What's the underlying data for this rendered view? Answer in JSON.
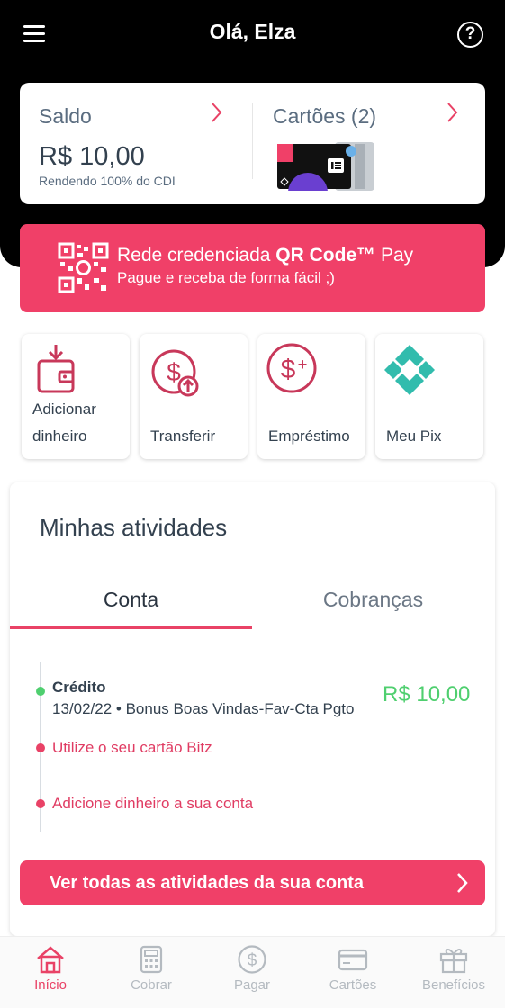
{
  "header": {
    "greeting": "Olá, Elza",
    "menu_icon": "hamburger-icon",
    "help_icon": "question-circle-icon"
  },
  "balance": {
    "saldo_label": "Saldo",
    "saldo_value": "R$ 10,00",
    "saldo_sub": "Rendendo 100% do CDI",
    "cartoes_label": "Cartões (2)"
  },
  "qr_banner": {
    "title_prefix": "Rede credenciada ",
    "title_bold": "QR Code™",
    "title_suffix": " Pay",
    "subtitle": "Pague e receba de forma fácil ;)"
  },
  "actions": [
    {
      "label": "Adicionar dinheiro",
      "icon": "wallet-add-icon"
    },
    {
      "label": "Transferir",
      "icon": "dollar-transfer-icon"
    },
    {
      "label": "Empréstimo",
      "icon": "dollar-plus-icon"
    },
    {
      "label": "Meu Pix",
      "icon": "pix-icon"
    }
  ],
  "actions_display": [
    "Adicionar dinheiro",
    "Transferir",
    "Empréstimo",
    "Meu Pix"
  ],
  "activities": {
    "title": "Minhas atividades",
    "tabs": [
      "Conta",
      "Cobranças"
    ],
    "active_tab": "Conta",
    "credit_title": "Crédito",
    "credit_date": "13/02/22",
    "credit_desc": "Bonus Boas Vindas-Fav-Cta Pgto",
    "credit_amount": "R$ 10,00",
    "tip1": "Utilize o seu cartão Bitz",
    "tip2": "Adicione dinheiro a sua conta",
    "see_all": "Ver todas as atividades da sua conta"
  },
  "nav": [
    {
      "label": "Início",
      "icon": "home-icon",
      "active": true
    },
    {
      "label": "Cobrar",
      "icon": "calculator-icon",
      "active": false
    },
    {
      "label": "Pagar",
      "icon": "dollar-circle-icon",
      "active": false
    },
    {
      "label": "Cartões",
      "icon": "credit-card-icon",
      "active": false
    },
    {
      "label": "Benefícios",
      "icon": "gift-icon",
      "active": false
    }
  ],
  "colors": {
    "brand_pink": "#f04068",
    "accent_pink": "#e94266",
    "success_green": "#4fcf6f",
    "header_black": "#000000",
    "text_dark": "#33414f",
    "pix_teal": "#32bcad"
  }
}
